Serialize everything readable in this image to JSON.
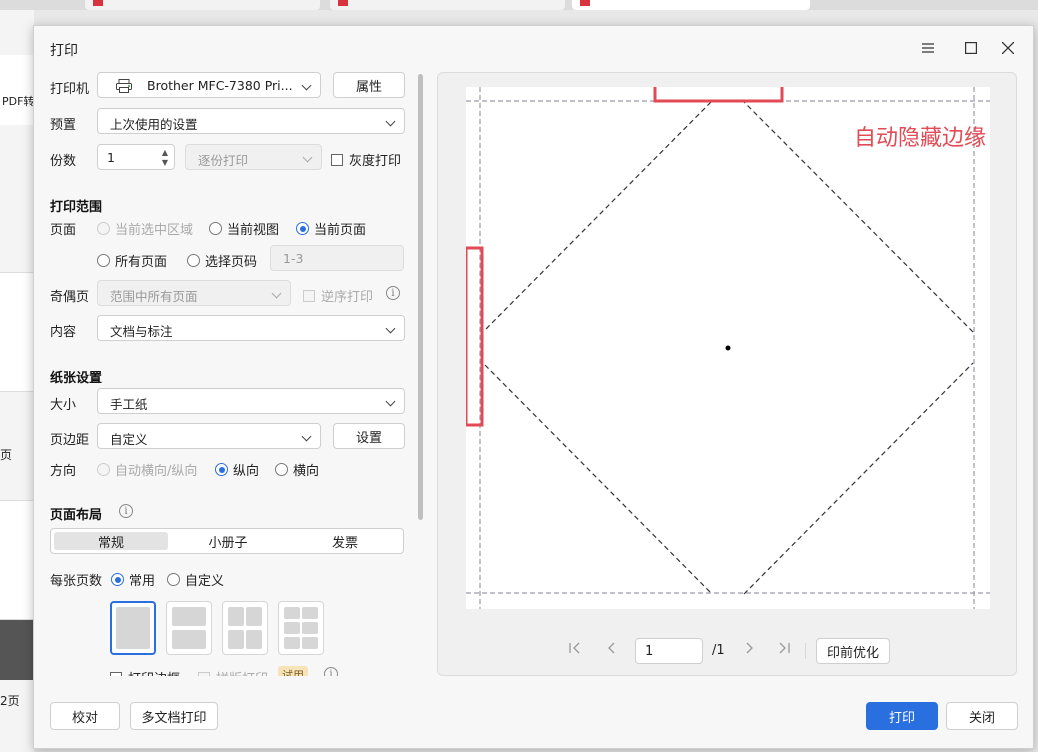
{
  "background": {
    "pdf_label": "PDF转",
    "page_label_1": "页",
    "page_label_2": "2页"
  },
  "dialog": {
    "title": "打印",
    "printer": {
      "label": "打印机",
      "value": "Brother MFC-7380 Pri...",
      "properties_button": "属性"
    },
    "preset": {
      "label": "预置",
      "value": "上次使用的设置"
    },
    "copies": {
      "label": "份数",
      "value": "1",
      "collate": "逐份打印",
      "grayscale": "灰度打印"
    },
    "print_range": {
      "section": "打印范围",
      "page_label": "页面",
      "options": [
        "当前选中区域",
        "当前视图",
        "当前页面",
        "所有页面",
        "选择页码"
      ],
      "selected": "当前页面",
      "page_range_placeholder": "1-3",
      "odd_even_label": "奇偶页",
      "odd_even_value": "范围中所有页面",
      "reverse": "逆序打印",
      "content_label": "内容",
      "content_value": "文档与标注"
    },
    "paper": {
      "section": "纸张设置",
      "size_label": "大小",
      "size_value": "手工纸",
      "margin_label": "页边距",
      "margin_value": "自定义",
      "margin_button": "设置",
      "orientation_label": "方向",
      "orientation_options": [
        "自动横向/纵向",
        "纵向",
        "横向"
      ],
      "orientation_selected": "纵向"
    },
    "layout": {
      "section": "页面布局",
      "tabs": [
        "常规",
        "小册子",
        "发票"
      ],
      "active_tab": "常规",
      "pages_per_sheet_label": "每张页数",
      "pps_options": [
        "常用",
        "自定义"
      ],
      "pps_selected": "常用",
      "print_border": "打印边框",
      "tile_print": "拼版打印",
      "trial_badge": "试用"
    },
    "preview": {
      "annotation": "自动隐藏边缘",
      "current_page": "1",
      "total_pages": "/1",
      "optimize_button": "印前优化"
    },
    "footer": {
      "proof_button": "校对",
      "multi_doc_button": "多文档打印",
      "print_button": "打印",
      "close_button": "关闭"
    }
  }
}
